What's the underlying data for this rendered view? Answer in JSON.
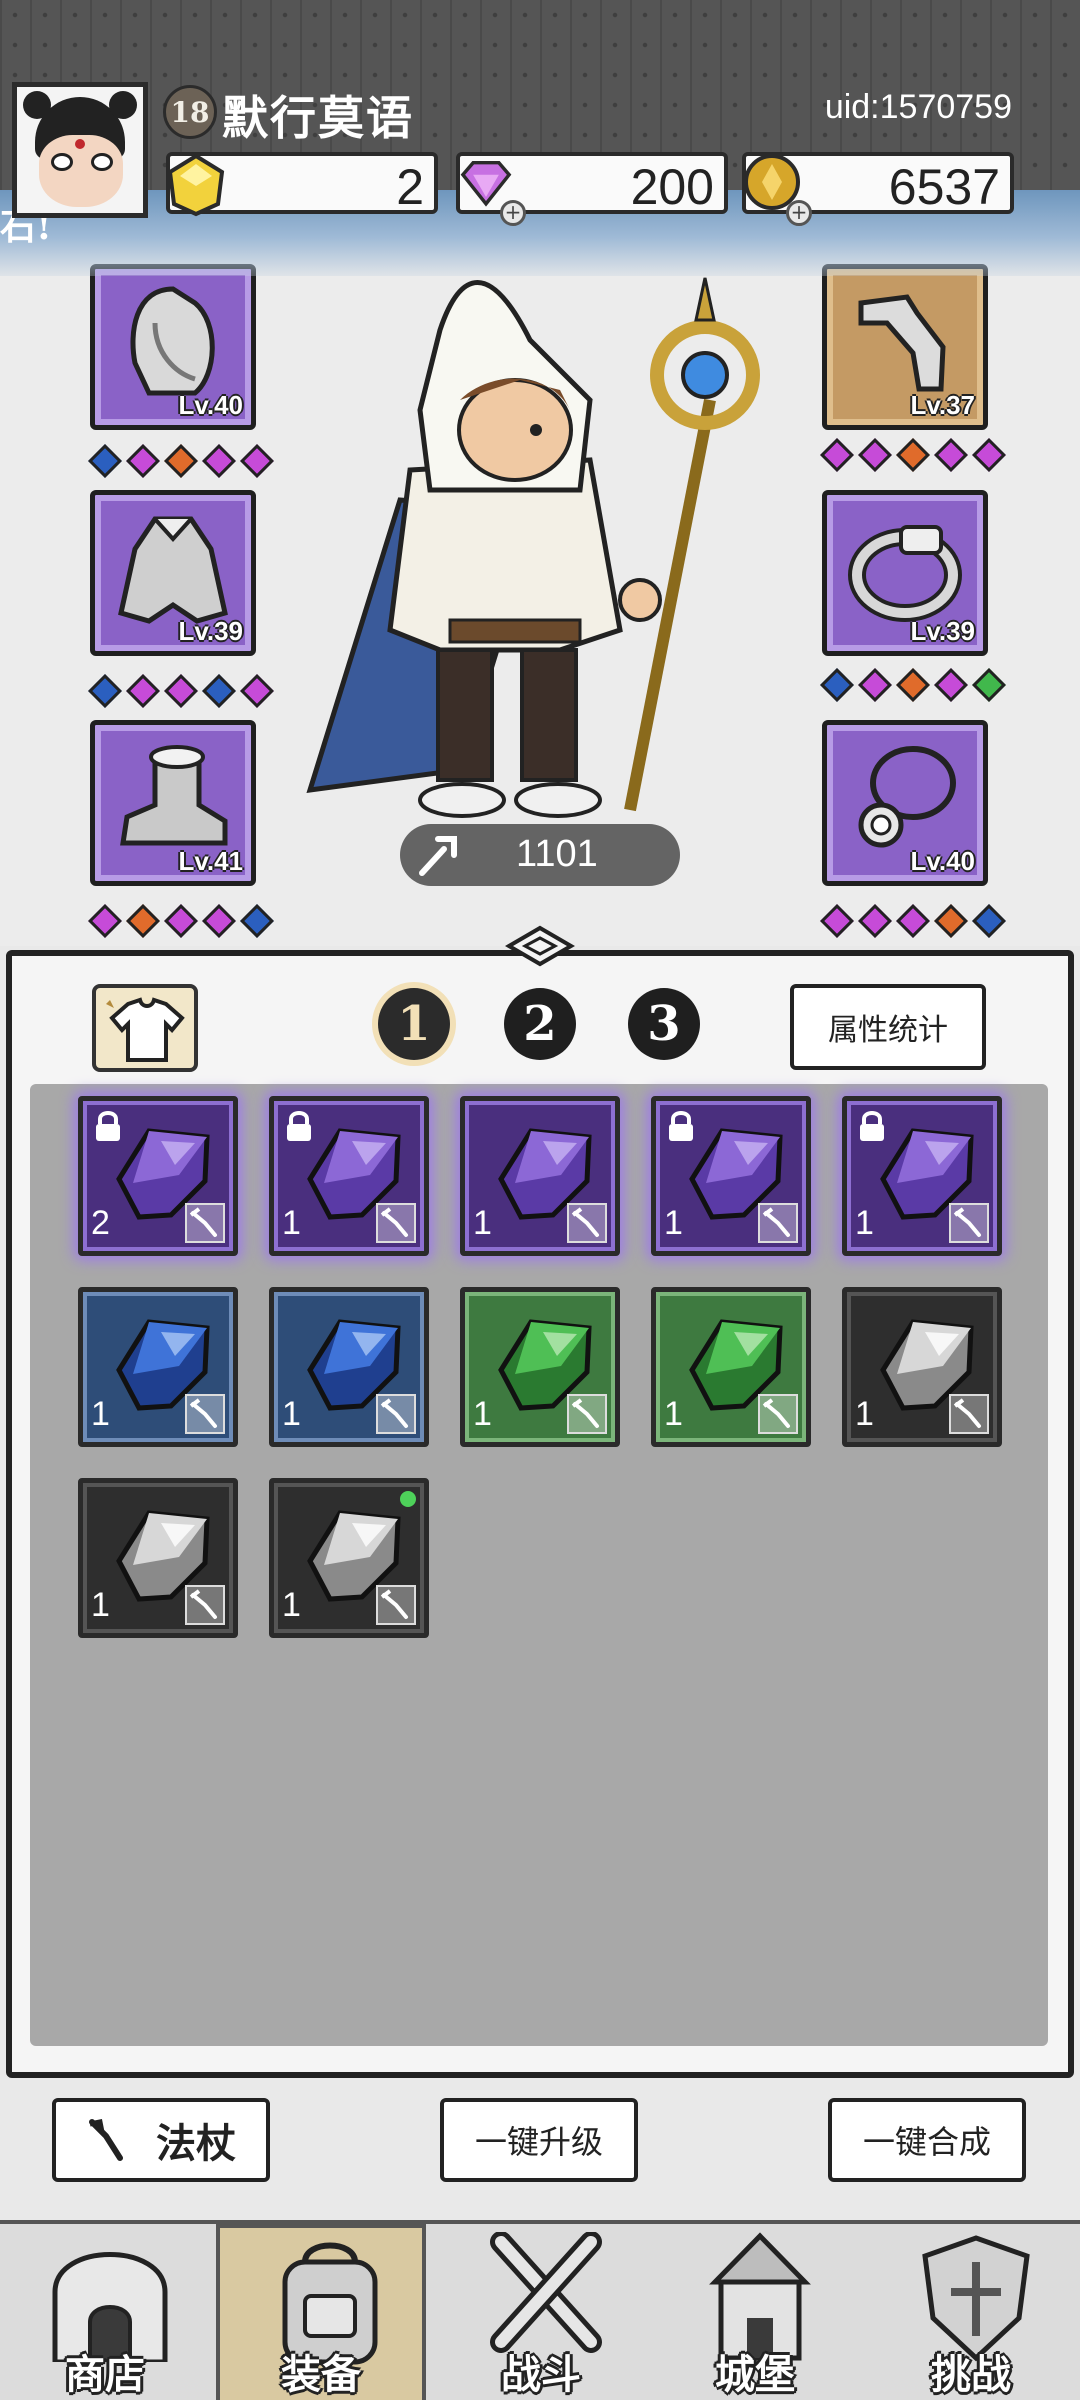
{
  "header": {
    "player_level": "18",
    "player_name": "默行莫语",
    "uid": "uid:1570759",
    "currencies": [
      {
        "name": "gold-crystal",
        "value": "2"
      },
      {
        "name": "diamond",
        "value": "200"
      },
      {
        "name": "coin",
        "value": "6537"
      }
    ],
    "ticker_text": "石!"
  },
  "equipment": {
    "left": [
      {
        "item": "hood",
        "level": "Lv.40",
        "gems": [
          "blue",
          "pink",
          "orange",
          "pink",
          "pink"
        ]
      },
      {
        "item": "cape",
        "level": "Lv.39",
        "gems": [
          "blue",
          "pink",
          "pink",
          "blue",
          "pink"
        ]
      },
      {
        "item": "boot",
        "level": "Lv.41",
        "gems": [
          "pink",
          "orange",
          "pink",
          "pink",
          "blue"
        ]
      }
    ],
    "right": [
      {
        "item": "glove",
        "level": "Lv.37",
        "gems": [
          "pink",
          "pink",
          "orange",
          "pink",
          "pink"
        ]
      },
      {
        "item": "ring",
        "level": "Lv.39",
        "gems": [
          "blue",
          "pink",
          "orange",
          "pink",
          "green"
        ]
      },
      {
        "item": "necklace",
        "level": "Lv.40",
        "gems": [
          "pink",
          "pink",
          "pink",
          "orange",
          "blue"
        ]
      }
    ],
    "power": "1101"
  },
  "bag": {
    "set_tabs": [
      "1",
      "2",
      "3"
    ],
    "active_set": "1",
    "stats_button": "属性统计",
    "gems": [
      {
        "color": "purple",
        "count": "2",
        "locked": true
      },
      {
        "color": "purple",
        "count": "1",
        "locked": true
      },
      {
        "color": "purple",
        "count": "1",
        "locked": false
      },
      {
        "color": "purple",
        "count": "1",
        "locked": true
      },
      {
        "color": "purple",
        "count": "1",
        "locked": true
      },
      {
        "color": "blue",
        "count": "1",
        "locked": false
      },
      {
        "color": "blue",
        "count": "1",
        "locked": false
      },
      {
        "color": "green",
        "count": "1",
        "locked": false
      },
      {
        "color": "green",
        "count": "1",
        "locked": false
      },
      {
        "color": "black",
        "count": "1",
        "locked": false
      },
      {
        "color": "black",
        "count": "1",
        "locked": false
      },
      {
        "color": "black",
        "count": "1",
        "locked": false,
        "new": true
      }
    ]
  },
  "actions": {
    "weapon_filter": "法杖",
    "upgrade_all": "一键升级",
    "merge_all": "一键合成"
  },
  "nav": [
    "商店",
    "装备",
    "战斗",
    "城堡",
    "挑战"
  ],
  "colors": {
    "purple_frame": "#8a62c7",
    "gem_blue": "#2b5fbf",
    "gem_pink": "#c64bd8",
    "gem_orange": "#e06b2b",
    "gem_green": "#41b84c"
  }
}
